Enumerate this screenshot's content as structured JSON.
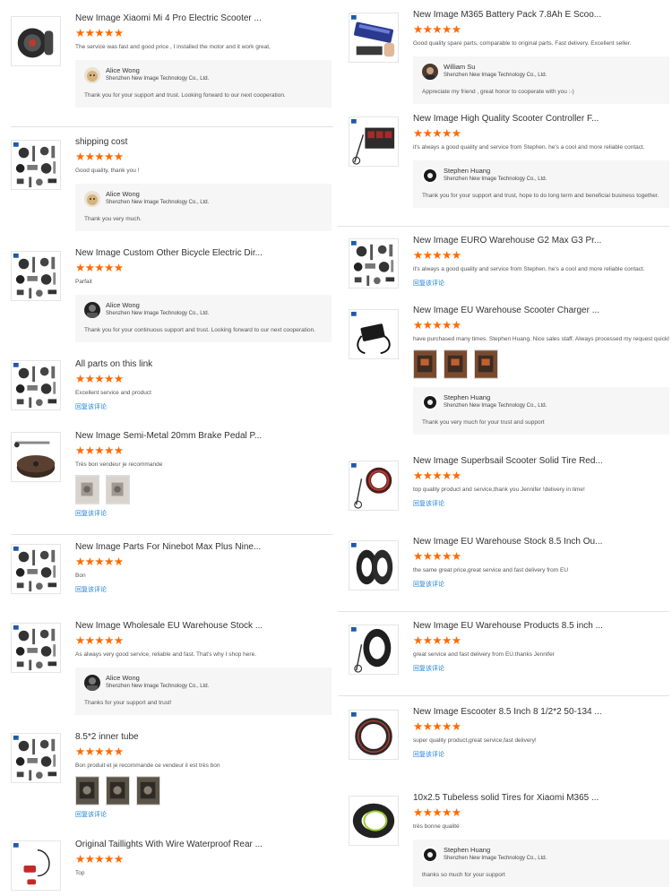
{
  "left": [
    {
      "title": "New Image Xiaomi Mi 4 Pro Electric Scooter ...",
      "stars": "★★★★★",
      "comment": "The service was fast and good price , I installed the motor and it work great,",
      "thumb": "thumb-motor",
      "reply": {
        "name": "Alice Wong",
        "company": "Shenzhen New Image Technology Co., Ltd.",
        "text": "Thank you for your support and trust. Looking forward to our next cooperation.",
        "avatar": "avatar-dog"
      }
    },
    {
      "title": "shipping cost",
      "stars": "★★★★★",
      "comment": "Good quality, thank you !",
      "thumb": "thumb-parts",
      "reply": {
        "name": "Alice Wong",
        "company": "Shenzhen New Image Technology Co., Ltd.",
        "text": "Thank you very much.",
        "avatar": "avatar-dog"
      }
    },
    {
      "title": "New Image Custom Other Bicycle Electric Dir...",
      "stars": "★★★★★",
      "comment": "Parfait",
      "thumb": "thumb-parts",
      "reply": {
        "name": "Alice Wong",
        "company": "Shenzhen New Image Technology Co., Ltd.",
        "text": "Thank you for your continuous support and trust. Looking forward to our next cooperation.",
        "avatar": "avatar-dark"
      }
    },
    {
      "title": "All parts on this link",
      "stars": "★★★★★",
      "comment": "Excellent service and product",
      "thumb": "thumb-parts",
      "reply_link": "回复该评论"
    },
    {
      "title": "New Image Semi-Metal 20mm Brake Pedal P...",
      "stars": "★★★★★",
      "comment": "Très bon vendeur je recommande",
      "thumb": "thumb-pedal",
      "photos": [
        "photo-light",
        "photo-light"
      ],
      "reply_link": "回复该评论"
    },
    {
      "title": "New Image Parts For Ninebot Max Plus Nine...",
      "stars": "★★★★★",
      "comment": "Bon",
      "thumb": "thumb-parts",
      "reply_link": "回复该评论"
    },
    {
      "title": "New Image Wholesale EU Warehouse Stock ...",
      "stars": "★★★★★",
      "comment": "As always very good service, reliable and fast. That's why I shop here.",
      "thumb": "thumb-parts",
      "reply": {
        "name": "Alice Wong",
        "company": "Shenzhen New Image Technology Co., Ltd.",
        "text": "Thanks for your support and trust!",
        "avatar": "avatar-dark"
      }
    },
    {
      "title": "8.5*2 inner tube",
      "stars": "★★★★★",
      "comment": "Bon produit et je recommande ce vendeur il est très bon",
      "thumb": "thumb-parts",
      "photos": [
        "photo-dark",
        "photo-dark",
        "photo-dark"
      ],
      "reply_link": "回复该评论"
    },
    {
      "title": "Original Taillights With Wire Waterproof Rear ...",
      "stars": "★★★★★",
      "comment": "Top",
      "thumb": "thumb-taillight"
    }
  ],
  "right": [
    {
      "title": "New Image M365 Battery Pack 7.8Ah E Scoo...",
      "stars": "★★★★★",
      "comment": "Good quality spare parts, comparable to original parts. Fast delivery. Excellent seller.",
      "thumb": "thumb-battery",
      "reply": {
        "name": "William Su",
        "company": "Shenzhen New Image Technology Co., Ltd.",
        "text": "Appreciate my friend , great honor to cooperate with you :-)",
        "avatar": "avatar-man"
      }
    },
    {
      "title": "New Image High Quality Scooter Controller F...",
      "stars": "★★★★★",
      "comment": "it's always a good quality and service from Stephen. he's a cool and more reliable contact.",
      "thumb": "thumb-controller",
      "reply": {
        "name": "Stephen Huang",
        "company": "Shenzhen New Image Technology Co., Ltd.",
        "text": "Thank you for your support and trust, hope to do long term and beneficial business together.",
        "avatar": "avatar-wheel"
      }
    },
    {
      "title": "New Image EURO Warehouse G2 Max G3 Pr...",
      "stars": "★★★★★",
      "comment": "it's always a good quality and service from Stephen. he's a cool and more reliable contact.",
      "thumb": "thumb-parts",
      "reply_link": "回复该评论"
    },
    {
      "title": "New Image EU Warehouse Scooter Charger ...",
      "stars": "★★★★★",
      "comment": "have purchased many times. Stephen Huang. Nice sales staff. Always processed my request quickly",
      "thumb": "thumb-charger",
      "photos": [
        "photo-box",
        "photo-box",
        "photo-box"
      ],
      "reply": {
        "name": "Stephen Huang",
        "company": "Shenzhen New Image Technology Co., Ltd.",
        "text": "Thank you very much for your trust and support",
        "avatar": "avatar-wheel"
      }
    },
    {
      "title": "New Image Superbsail Scooter Solid Tire Red...",
      "stars": "★★★★★",
      "comment": "top quality product and service,thank you Jennifer !delivery in time!",
      "thumb": "thumb-tire-red",
      "reply_link": "回复该评论"
    },
    {
      "title": "New Image EU Warehouse Stock 8.5 Inch Ou...",
      "stars": "★★★★★",
      "comment": "the same great price,great service and fast delivery from EU",
      "thumb": "thumb-tires",
      "reply_link": "回复该评论"
    },
    {
      "title": "New Image EU Warehouse Products 8.5 inch ...",
      "stars": "★★★★★",
      "comment": "great service and fast delivery from EU.thanks Jennifer",
      "thumb": "thumb-tire",
      "reply_link": "回复该评论"
    },
    {
      "title": "New Image Escooter 8.5 Inch 8 1/2*2 50-134 ...",
      "stars": "★★★★★",
      "comment": "super quality product,great service,fast delivery!",
      "thumb": "thumb-tube",
      "reply_link": "回复该评论"
    },
    {
      "title": "10x2.5 Tubeless solid Tires for Xiaomi M365 ...",
      "stars": "★★★★★",
      "comment": "très bonne qualité",
      "thumb": "thumb-tire-green",
      "reply": {
        "name": "Stephen Huang",
        "company": "Shenzhen New Image Technology Co., Ltd.",
        "text": "thanks so much for your support",
        "avatar": "avatar-wheel"
      }
    }
  ]
}
